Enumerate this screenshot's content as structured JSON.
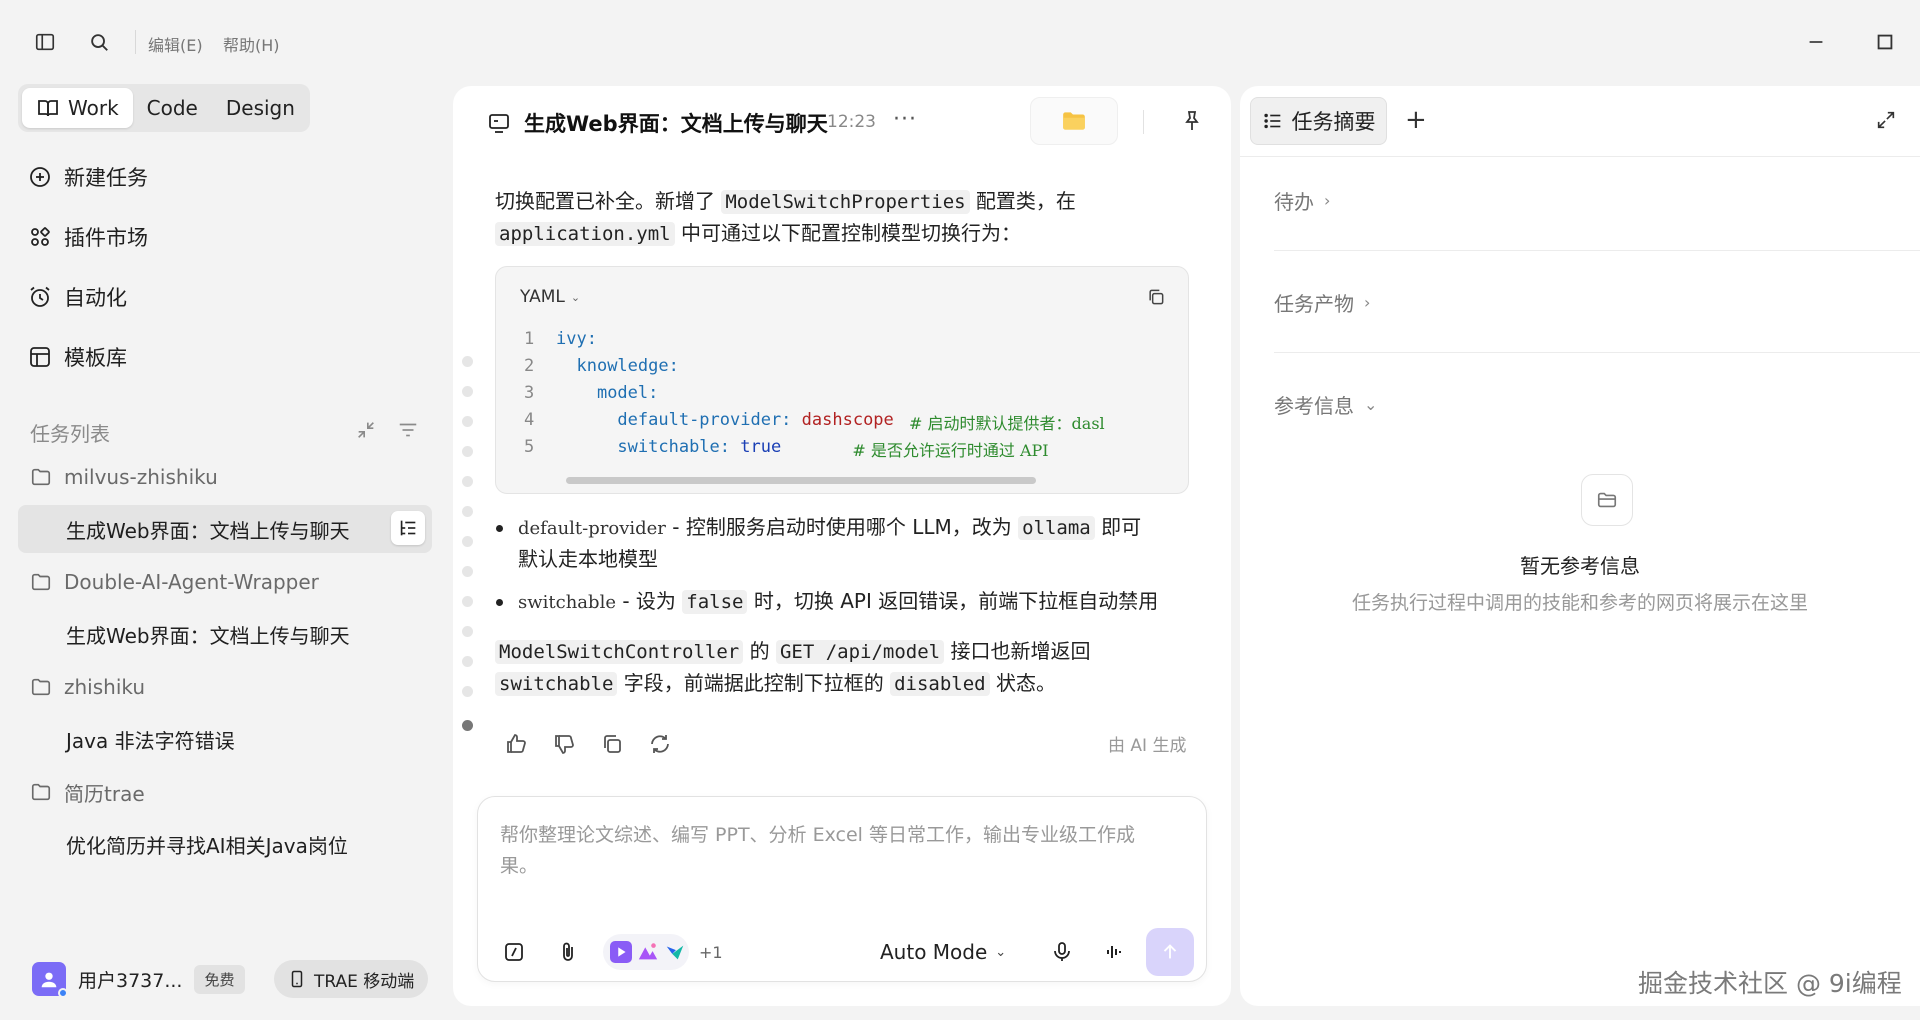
{
  "window": {
    "menus": [
      "编辑(E)",
      "帮助(H)"
    ]
  },
  "sidebar": {
    "mode_tabs": [
      "Work",
      "Code",
      "Design"
    ],
    "active_mode": "Work",
    "nav": [
      {
        "label": "新建任务",
        "icon": "plus-circle-icon"
      },
      {
        "label": "插件市场",
        "icon": "plugin-grid-icon"
      },
      {
        "label": "自动化",
        "icon": "alarm-clock-icon"
      },
      {
        "label": "模板库",
        "icon": "template-icon"
      }
    ],
    "task_list_title": "任务列表",
    "groups": [
      {
        "folder": "milvus-zhishiku",
        "tasks": [
          "生成Web界面：文档上传与聊天"
        ]
      },
      {
        "folder": "Double-AI-Agent-Wrapper",
        "tasks": [
          "生成Web界面：文档上传与聊天"
        ]
      },
      {
        "folder": "zhishiku",
        "tasks": [
          "Java 非法字符错误"
        ]
      },
      {
        "folder": "简历trae",
        "tasks": [
          "优化简历并寻找AI相关Java岗位"
        ]
      }
    ],
    "user": {
      "name": "用户3737...",
      "plan": "免费",
      "mobile_label": "TRAE 移动端"
    }
  },
  "chat": {
    "title": "生成Web界面：文档上传与聊天",
    "time": "12:23",
    "more": "···",
    "intro": {
      "t1": "切换配置已补全。新增了 ",
      "c1": "ModelSwitchProperties",
      "t2": " 配置类，在",
      "c2": "application.yml",
      "t3": " 中可通过以下配置控制模型切换行为："
    },
    "code": {
      "language": "YAML",
      "lines": [
        {
          "n": "1",
          "key": "ivy:",
          "indent": "",
          "value": "",
          "comment": ""
        },
        {
          "n": "2",
          "key": "knowledge:",
          "indent": "  ",
          "value": "",
          "comment": ""
        },
        {
          "n": "3",
          "key": "model:",
          "indent": "    ",
          "value": "",
          "comment": ""
        },
        {
          "n": "4",
          "key": "default-provider:",
          "indent": "      ",
          "value": " dashscope",
          "comment": "   # 启动时默认提供者：dasl"
        },
        {
          "n": "5",
          "key": "switchable:",
          "indent": "      ",
          "value": " true",
          "comment": "              # 是否允许运行时通过 API"
        }
      ]
    },
    "bullets": [
      {
        "code": "default-provider",
        "t1": " - 控制服务启动时使用哪个 LLM，改为 ",
        "c2": "ollama",
        "t2": " 即可",
        "t3": "默认走本地模型"
      },
      {
        "code": "switchable",
        "t1": " - 设为 ",
        "c2": "false",
        "t2": " 时，切换 API 返回错误，前端下拉框自动禁用"
      }
    ],
    "outro": {
      "c1": "ModelSwitchController",
      "t1": " 的 ",
      "c2": "GET /api/model",
      "t2": " 接口也新增返回",
      "c3": "switchable",
      "t3": " 字段，前端据此控制下拉框的 ",
      "c4": "disabled",
      "t4": " 状态。"
    },
    "ai_generated": "由 AI 生成",
    "input": {
      "placeholder": "帮你整理论文综述、编写 PPT、分析 Excel 等日常工作，输出专业级工作成果。",
      "plugin_more": "+1",
      "mode": "Auto Mode"
    }
  },
  "right_panel": {
    "tab": "任务摘要",
    "sections": [
      "待办",
      "任务产物",
      "参考信息"
    ],
    "empty_title": "暂无参考信息",
    "empty_subtitle": "任务执行过程中调用的技能和参考的网页将展示在这里"
  },
  "watermark": "掘金技术社区 @ 9i编程",
  "colors": {
    "accent": "#7b6cf6",
    "send_disabled": "#d9d4fb",
    "folder": "#f6c343"
  }
}
